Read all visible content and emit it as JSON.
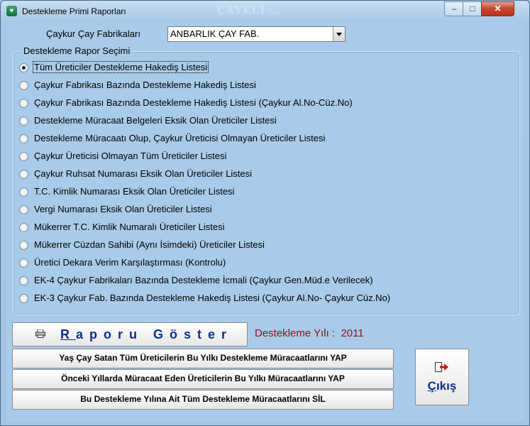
{
  "window": {
    "title": "Destekleme Primi Raporları",
    "watermark": "ÇAYELİ ..."
  },
  "factory": {
    "label": "Çaykur Çay Fabrikaları",
    "selected": "ANBARLIK ÇAY FAB."
  },
  "report_group": {
    "title": "Destekleme Rapor Seçimi",
    "options": [
      {
        "label": "Tüm Üreticiler Destekleme Hakediş Listesi",
        "checked": true
      },
      {
        "label": "Çaykur Fabrikası Bazında Destekleme Hakediş Listesi",
        "checked": false
      },
      {
        "label": "Çaykur Fabrikası Bazında Destekleme Hakediş Listesi (Çaykur Al.No-Cüz.No)",
        "checked": false
      },
      {
        "label": "Destekleme Müracaat Belgeleri Eksik Olan Üreticiler Listesi",
        "checked": false
      },
      {
        "label": "Destekleme Müracaatı Olup, Çaykur Üreticisi Olmayan Üreticiler Listesi",
        "checked": false
      },
      {
        "label": "Çaykur Üreticisi Olmayan Tüm Üreticiler Listesi",
        "checked": false
      },
      {
        "label": "Çaykur Ruhsat Numarası Eksik Olan Üreticiler Listesi",
        "checked": false
      },
      {
        "label": "T.C. Kimlik Numarası Eksik Olan Üreticiler Listesi",
        "checked": false
      },
      {
        "label": "Vergi Numarası Eksik Olan Üreticiler Listesi",
        "checked": false
      },
      {
        "label": "Mükerrer T.C. Kimlik Numaralı Üreticiler Listesi",
        "checked": false
      },
      {
        "label": "Mükerrer Cüzdan Sahibi (Aynı İsimdeki) Üreticiler Listesi",
        "checked": false
      },
      {
        "label": "Üretici Dekara Verim Karşılaştırması (Kontrolu)",
        "checked": false
      },
      {
        "label": "EK-4 Çaykur Fabrikaları Bazında Destekleme İcmali (Çaykur Gen.Müd.e Verilecek)",
        "checked": false
      },
      {
        "label": "EK-3 Çaykur Fab. Bazında Destekleme Hakediş Listesi (Çaykur Al.No- Çaykur Cüz.No)",
        "checked": false
      }
    ]
  },
  "show_report": {
    "first_letter": "R",
    "rest": "aporu Göster"
  },
  "year": {
    "label": "Destekleme Yılı :",
    "value": "2011"
  },
  "actions": [
    {
      "label": "Yaş Çay Satan Tüm Üreticilerin Bu Yılkı Destekleme Müracaatlarını YAP"
    },
    {
      "label": "Önceki Yıllarda Müracaat Eden Üreticilerin Bu Yılkı Müracaatlarını YAP"
    },
    {
      "label": "Bu Destekleme Yılına Ait Tüm Destekleme Müracaatlarını SİL"
    }
  ],
  "exit": {
    "first_letter": "Ç",
    "rest": "ıkış"
  },
  "icons": {
    "app": "tea-leaf-icon",
    "print": "printer-icon",
    "exit": "exit-arrow-icon"
  },
  "colors": {
    "background": "#a8cbe9",
    "year_text": "#8b1218",
    "button_text": "#0d2f8c",
    "close_button": "#c74a32"
  }
}
